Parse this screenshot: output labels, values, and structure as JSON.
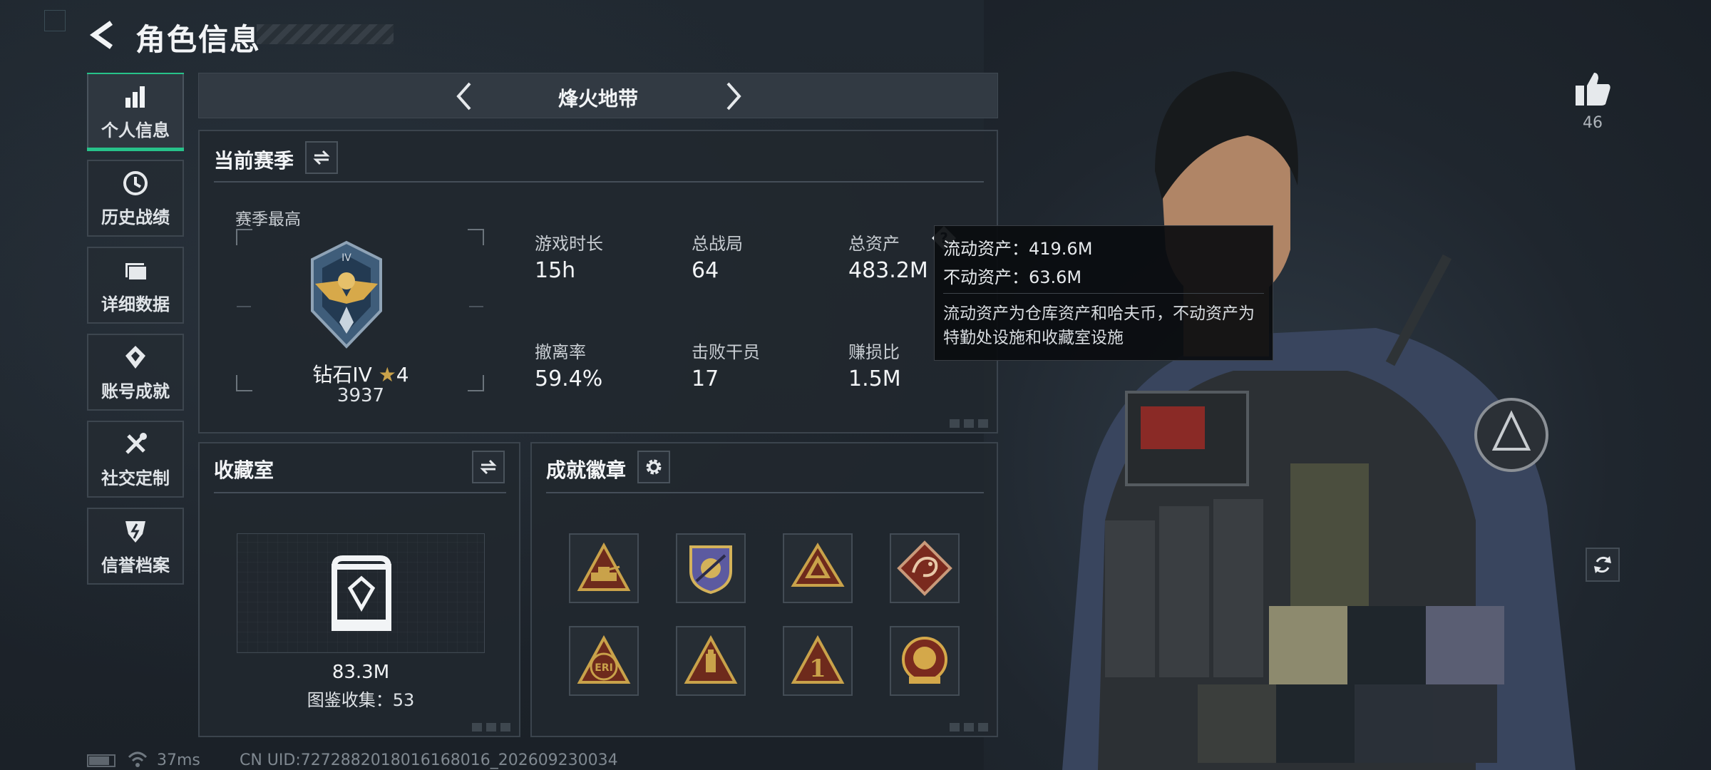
{
  "header": {
    "title": "角色信息"
  },
  "sidebar": {
    "items": [
      {
        "label": "个人信息",
        "icon": "bar-chart-icon",
        "active": true
      },
      {
        "label": "历史战绩",
        "icon": "clock-icon"
      },
      {
        "label": "详细数据",
        "icon": "folder-icon"
      },
      {
        "label": "账号成就",
        "icon": "medal-icon"
      },
      {
        "label": "社交定制",
        "icon": "tools-icon"
      },
      {
        "label": "信誉档案",
        "icon": "shield-bolt-icon"
      }
    ]
  },
  "mode_bar": {
    "title": "烽火地带"
  },
  "season": {
    "title": "当前赛季",
    "best_label": "赛季最高",
    "rank_name": "钻石IV",
    "rank_stars": "4",
    "rank_score": "3937",
    "stats": [
      {
        "label": "游戏时长",
        "value": "15h"
      },
      {
        "label": "总战局",
        "value": "64"
      },
      {
        "label": "总资产",
        "value": "483.2M"
      },
      {
        "label": "撤离率",
        "value": "59.4%"
      },
      {
        "label": "击败干员",
        "value": "17"
      },
      {
        "label": "赚损比",
        "value": "1.5M"
      }
    ]
  },
  "tooltip": {
    "liquid": "流动资产：419.6M",
    "fixed": "不动资产：63.6M",
    "desc": "流动资产为仓库资产和哈夫币，不动资产为特勤处设施和收藏室设施"
  },
  "collection": {
    "title": "收藏室",
    "value": "83.3M",
    "count_text": "图鉴收集：53"
  },
  "achievements": {
    "title": "成就徽章",
    "badges": [
      "tank-badge-icon",
      "shield-emblem-badge-icon",
      "eagle-triangle-badge-icon",
      "dragon-badge-icon",
      "eri-badge-icon",
      "usb-triangle-badge-icon",
      "number-one-badge-icon",
      "lion-crest-badge-icon"
    ],
    "badge_texts": {
      "eri": "ERI",
      "one": "1"
    }
  },
  "likes": {
    "count": "46"
  },
  "status": {
    "ping": "37ms",
    "uid": "CN UID:7272882018016168016_202609230034"
  },
  "colors": {
    "accent": "#27c28a",
    "gold": "#c9a24a",
    "badge_red": "#7a2a1e"
  }
}
